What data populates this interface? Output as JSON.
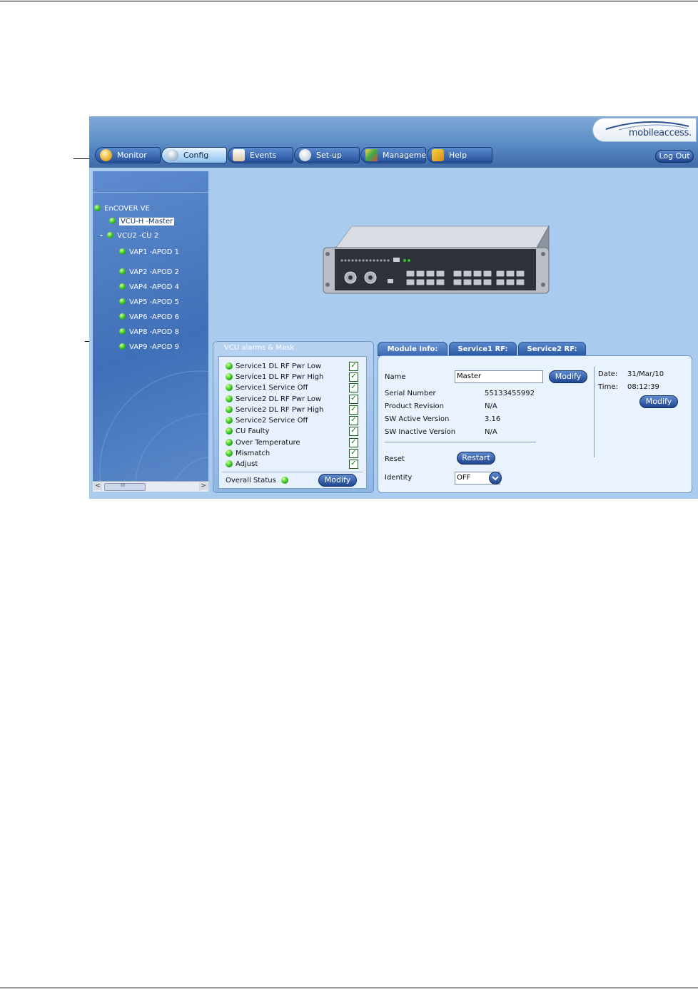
{
  "nav": {
    "tabs": [
      {
        "label": "Monitor"
      },
      {
        "label": "Config"
      },
      {
        "label": "Events"
      },
      {
        "label": "Set-up"
      },
      {
        "label": "Management"
      },
      {
        "label": "Help"
      }
    ],
    "logout_label": "Log Out",
    "logo_text": "mobileaccess."
  },
  "tree": {
    "nodes": [
      {
        "label": "EnCOVER VE"
      },
      {
        "label": "VCU-H -Master"
      },
      {
        "label": "VCU2 -CU 2"
      },
      {
        "label": "VAP1 -APOD 1"
      },
      {
        "label": "VAP2 -APOD 2"
      },
      {
        "label": "VAP4 -APOD 4"
      },
      {
        "label": "VAP5 -APOD 5"
      },
      {
        "label": "VAP6 -APOD 6"
      },
      {
        "label": "VAP8 -APOD 8"
      },
      {
        "label": "VAP9 -APOD 9"
      }
    ],
    "collapse_glyph": "-",
    "scroll_left": "<",
    "scroll_right": ">",
    "scroll_grip": "III"
  },
  "alarms": {
    "title": "VCU alarms & Mask",
    "items": [
      {
        "label": "Service1 DL RF Pwr Low",
        "checked": "✓"
      },
      {
        "label": "Service1 DL RF Pwr High",
        "checked": "✓"
      },
      {
        "label": "Service1 Service Off",
        "checked": "✓"
      },
      {
        "label": "Service2 DL RF Pwr Low",
        "checked": "✓"
      },
      {
        "label": "Service2 DL RF Pwr High",
        "checked": "✓"
      },
      {
        "label": "Service2 Service Off",
        "checked": "✓"
      },
      {
        "label": "CU Faulty",
        "checked": "✓"
      },
      {
        "label": "Over Temperature",
        "checked": "✓"
      },
      {
        "label": "Mismatch",
        "checked": "✓"
      },
      {
        "label": "Adjust",
        "checked": "✓"
      }
    ],
    "overall_label": "Overall Status",
    "modify_label": "Modify"
  },
  "module": {
    "tabs": [
      {
        "label": "Module Info:"
      },
      {
        "label": "Service1 RF:"
      },
      {
        "label": "Service2 RF:"
      }
    ],
    "name_label": "Name",
    "name_value": "Master",
    "modify_label": "Modify",
    "serial_label": "Serial Number",
    "serial_value": "55133455992",
    "product_label": "Product Revision",
    "product_value": "N/A",
    "sw_active_label": "SW Active Version",
    "sw_active_value": "3.16",
    "sw_inactive_label": "SW Inactive Version",
    "sw_inactive_value": "N/A",
    "reset_label": "Reset",
    "restart_label": "Restart",
    "identity_label": "Identity",
    "identity_value": "OFF",
    "date_label": "Date:",
    "date_value": "31/Mar/10",
    "time_label": "Time:",
    "time_value": "08:12:39",
    "datetime_modify_label": "Modify"
  }
}
